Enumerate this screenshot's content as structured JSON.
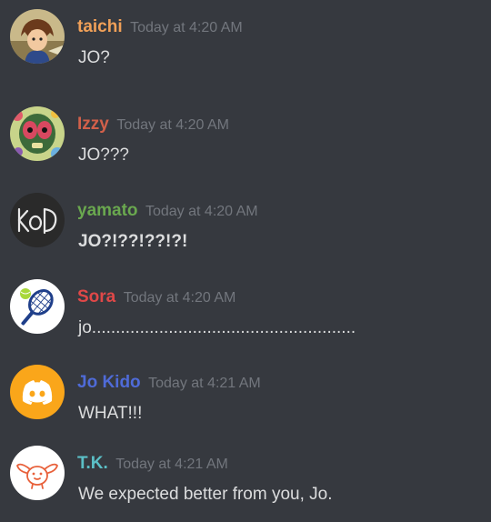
{
  "messages": [
    {
      "author": "taichi",
      "author_color": "#f0a058",
      "timestamp": "Today at 4:20 AM",
      "text": "JO?",
      "avatar_icon": "taichi-avatar-icon"
    },
    {
      "author": "Izzy",
      "author_color": "#d2604a",
      "timestamp": "Today at 4:20 AM",
      "text": "JO???",
      "avatar_icon": "izzy-avatar-icon"
    },
    {
      "author": "yamato",
      "author_color": "#6aa84f",
      "timestamp": "Today at 4:20 AM",
      "text": "JO?!??!??!?!",
      "avatar_icon": "yamato-avatar-icon"
    },
    {
      "author": "Sora",
      "author_color": "#e04848",
      "timestamp": "Today at 4:20 AM",
      "text": "jo.......................................................",
      "avatar_icon": "tennis-racket-avatar-icon"
    },
    {
      "author": "Jo Kido",
      "author_color": "#4f6bd8",
      "timestamp": "Today at 4:21 AM",
      "text": "WHAT!!!",
      "avatar_icon": "discord-logo-avatar-icon"
    },
    {
      "author": "T.K.",
      "author_color": "#5bbfc6",
      "timestamp": "Today at 4:21 AM",
      "text": "We expected better from you, Jo.",
      "avatar_icon": "patamon-avatar-icon"
    }
  ],
  "colors": {
    "background": "#36393f",
    "message_text": "#dcddde",
    "timestamp": "#72767d"
  }
}
